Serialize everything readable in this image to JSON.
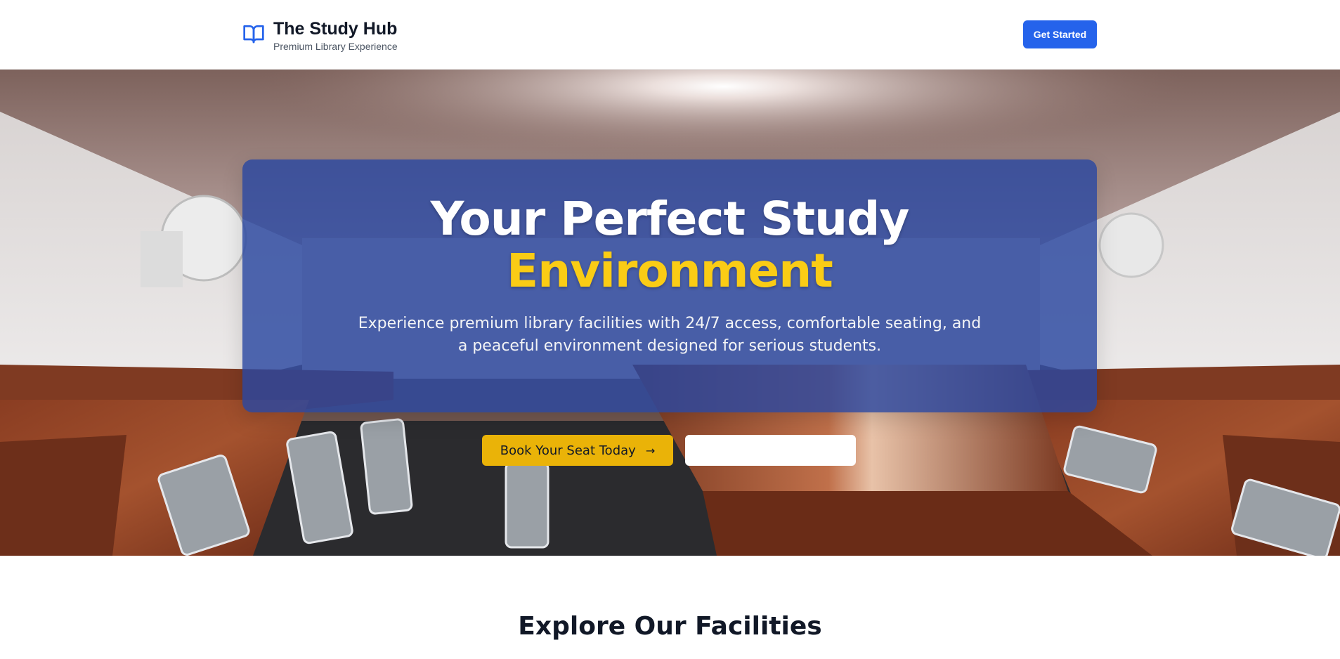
{
  "header": {
    "brand_title": "The Study Hub",
    "brand_subtitle": "Premium Library Experience",
    "brand_icon": "open-book-icon",
    "cta_label": "Get Started",
    "cta_color": "#2563eb"
  },
  "hero": {
    "title_line1": "Your Perfect Study",
    "title_line2": "Environment",
    "accent_color": "#facc15",
    "card_color": "#2947a0",
    "description": "Experience premium library facilities with 24/7 access, comfortable seating, and a peaceful environment designed for serious students.",
    "primary_button": {
      "label": "Book Your Seat Today",
      "icon": "arrow-right-icon",
      "color": "#eab308"
    },
    "secondary_button": {
      "label": ""
    }
  },
  "facilities": {
    "title": "Explore Our Facilities",
    "subtitle": ""
  }
}
